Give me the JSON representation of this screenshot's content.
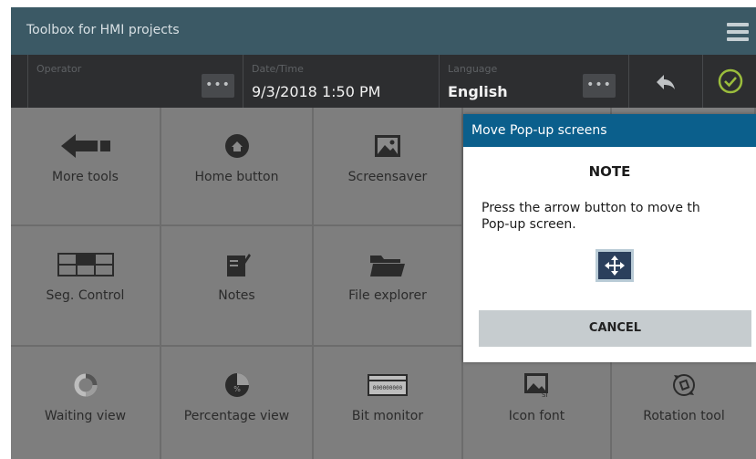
{
  "titlebar": {
    "title": "Toolbox for HMI projects",
    "menu_icon": "hamburger-menu-icon"
  },
  "infobar": {
    "operator_label": "Operator",
    "operator_value": "",
    "datetime_label": "Date/Time",
    "datetime_value": "9/3/2018 1:50 PM",
    "language_label": "Language",
    "language_value": "English",
    "dots": "•••",
    "back_icon": "back-arrow-icon",
    "confirm_icon": "check-circle-icon"
  },
  "tiles": [
    {
      "label": "More tools",
      "icon": "arrow-left-icon"
    },
    {
      "label": "Home button",
      "icon": "home-icon"
    },
    {
      "label": "Screensaver",
      "icon": "image-icon"
    },
    {
      "label": "Seg. Control",
      "icon": "segmented-control-icon"
    },
    {
      "label": "Notes",
      "icon": "notes-icon"
    },
    {
      "label": "File explorer",
      "icon": "folder-icon"
    },
    {
      "label": "Waiting view",
      "icon": "spinner-icon"
    },
    {
      "label": "Percentage view",
      "icon": "pie-percentage-icon"
    },
    {
      "label": "Bit monitor",
      "icon": "bit-monitor-icon"
    },
    {
      "label": "Icon font",
      "icon": "icon-font-icon"
    },
    {
      "label": "Rotation tool",
      "icon": "rotation-icon"
    }
  ],
  "dialog": {
    "title": "Move Pop-up screens",
    "note": "NOTE",
    "text": "Press the arrow button to move th\nPop-up screen.",
    "move_icon": "move-arrows-icon",
    "cancel_label": "CANCEL"
  },
  "colors": {
    "titlebar": "#3b5965",
    "infobar": "#2d2e30",
    "tile": "#7e7e7e",
    "dialog_header": "#0b5f8c",
    "confirm_green": "#9bbd3c"
  }
}
